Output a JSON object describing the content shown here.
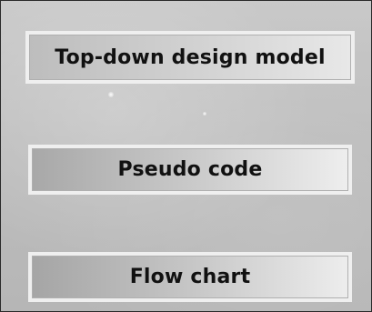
{
  "menu": {
    "items": [
      {
        "label": "Top-down design model"
      },
      {
        "label": "Pseudo code"
      },
      {
        "label": "Flow chart"
      }
    ]
  },
  "colors": {
    "background": "#c0c0c0",
    "button_border": "#efefef",
    "text": "#111111"
  }
}
